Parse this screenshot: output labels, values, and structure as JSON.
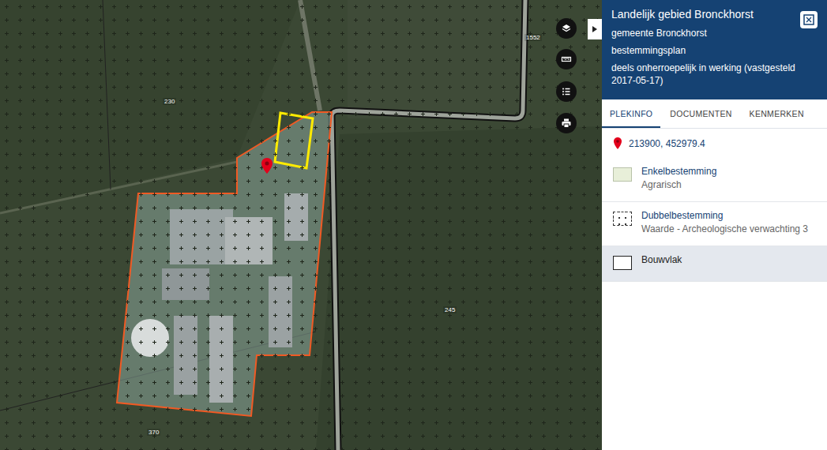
{
  "map": {
    "labels": [
      {
        "text": "230"
      },
      {
        "text": "1552"
      },
      {
        "text": "245"
      },
      {
        "text": "370"
      }
    ]
  },
  "panel": {
    "title": "Landelijk gebied Bronckhorst",
    "lines": [
      "gemeente Bronckhorst",
      "bestemmingsplan",
      "deels onherroepelijk in werking (vastgesteld 2017-05-17)"
    ]
  },
  "tabs": [
    {
      "label": "PLEKINFO",
      "selected": true
    },
    {
      "label": "DOCUMENTEN",
      "selected": false
    },
    {
      "label": "KENMERKEN",
      "selected": false
    }
  ],
  "location": {
    "coordinates": "213900, 452979.4"
  },
  "items": [
    {
      "kind": "fill",
      "title": "Enkelbestemming",
      "subtitle": "Agrarisch",
      "selected": false
    },
    {
      "kind": "dots",
      "title": "Dubbelbestemming",
      "subtitle": "Waarde - Archeologische verwachting 3",
      "selected": false
    },
    {
      "kind": "outline",
      "title": "Bouwvlak",
      "subtitle": "",
      "selected": true
    }
  ]
}
